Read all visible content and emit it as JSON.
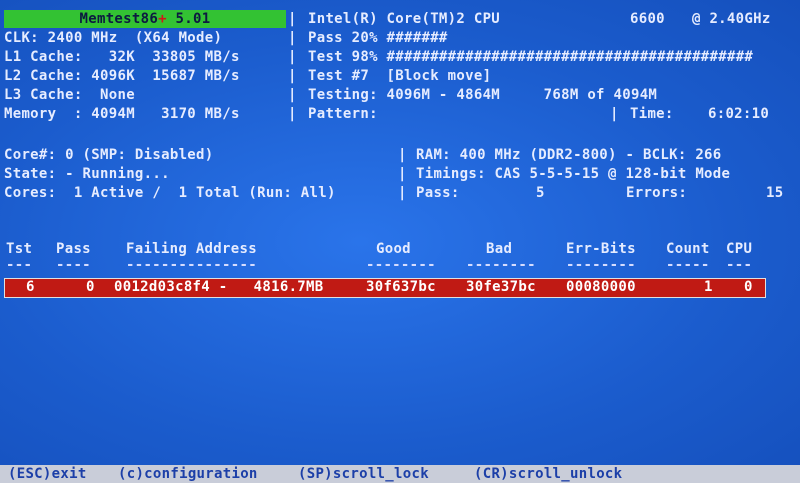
{
  "header": {
    "title": "Memtest86",
    "title_plus": "+",
    "version": " 5.01",
    "cpu_name": "Intel(R) Core(TM)2 CPU",
    "cpu_model": "6600",
    "cpu_speed": "@ 2.40GHz"
  },
  "left_info": {
    "clk": "CLK: 2400 MHz  (X64 Mode)",
    "l1": "L1 Cache:   32K  33805 MB/s",
    "l2": "L2 Cache: 4096K  15687 MB/s",
    "l3": "L3 Cache:  None",
    "memory": "Memory  : 4094M   3170 MB/s"
  },
  "right_info": {
    "pass": "Pass 20% #######",
    "test": "Test 98% ##########################################",
    "test_num": "Test #7  [Block move]",
    "testing": "Testing: 4096M - 4864M     768M of 4094M",
    "pattern": "Pattern:",
    "time_label": "Time:",
    "time_value": "6:02:10"
  },
  "state": {
    "core": "Core#: 0 (SMP: Disabled)",
    "state": "State: - Running...",
    "cores": "Cores:  1 Active /  1 Total (Run: All)",
    "ram": "RAM: 400 MHz (DDR2-800) - BCLK: 266",
    "timings": "Timings: CAS 5-5-5-15 @ 128-bit Mode",
    "pass_label": "Pass:",
    "pass_value": "5",
    "errors_label": "Errors:",
    "errors_value": "15"
  },
  "table": {
    "headers": [
      "Tst",
      "Pass",
      "Failing Address",
      "Good",
      "Bad",
      "Err-Bits",
      "Count",
      "CPU"
    ],
    "dashes": [
      "---",
      "----",
      "---------------",
      "--------",
      "--------",
      "--------",
      "-----",
      "---"
    ],
    "row": {
      "tst": "6",
      "pass": "0",
      "address": "0012d03c8f4 -   4816.7MB",
      "good": "30f637bc",
      "bad": "30fe37bc",
      "errbits": "00080000",
      "count": "1",
      "cpu": "0"
    }
  },
  "footer": {
    "esc": "(ESC)exit",
    "config": "(c)configuration",
    "scroll_lock": "(SP)scroll_lock",
    "scroll_unlock": "(CR)scroll_unlock"
  },
  "colors": {
    "background": "#1d63d6",
    "title_bar": "#33c233",
    "error_row": "#c01a14",
    "footer_bar": "#c9cdd9"
  }
}
